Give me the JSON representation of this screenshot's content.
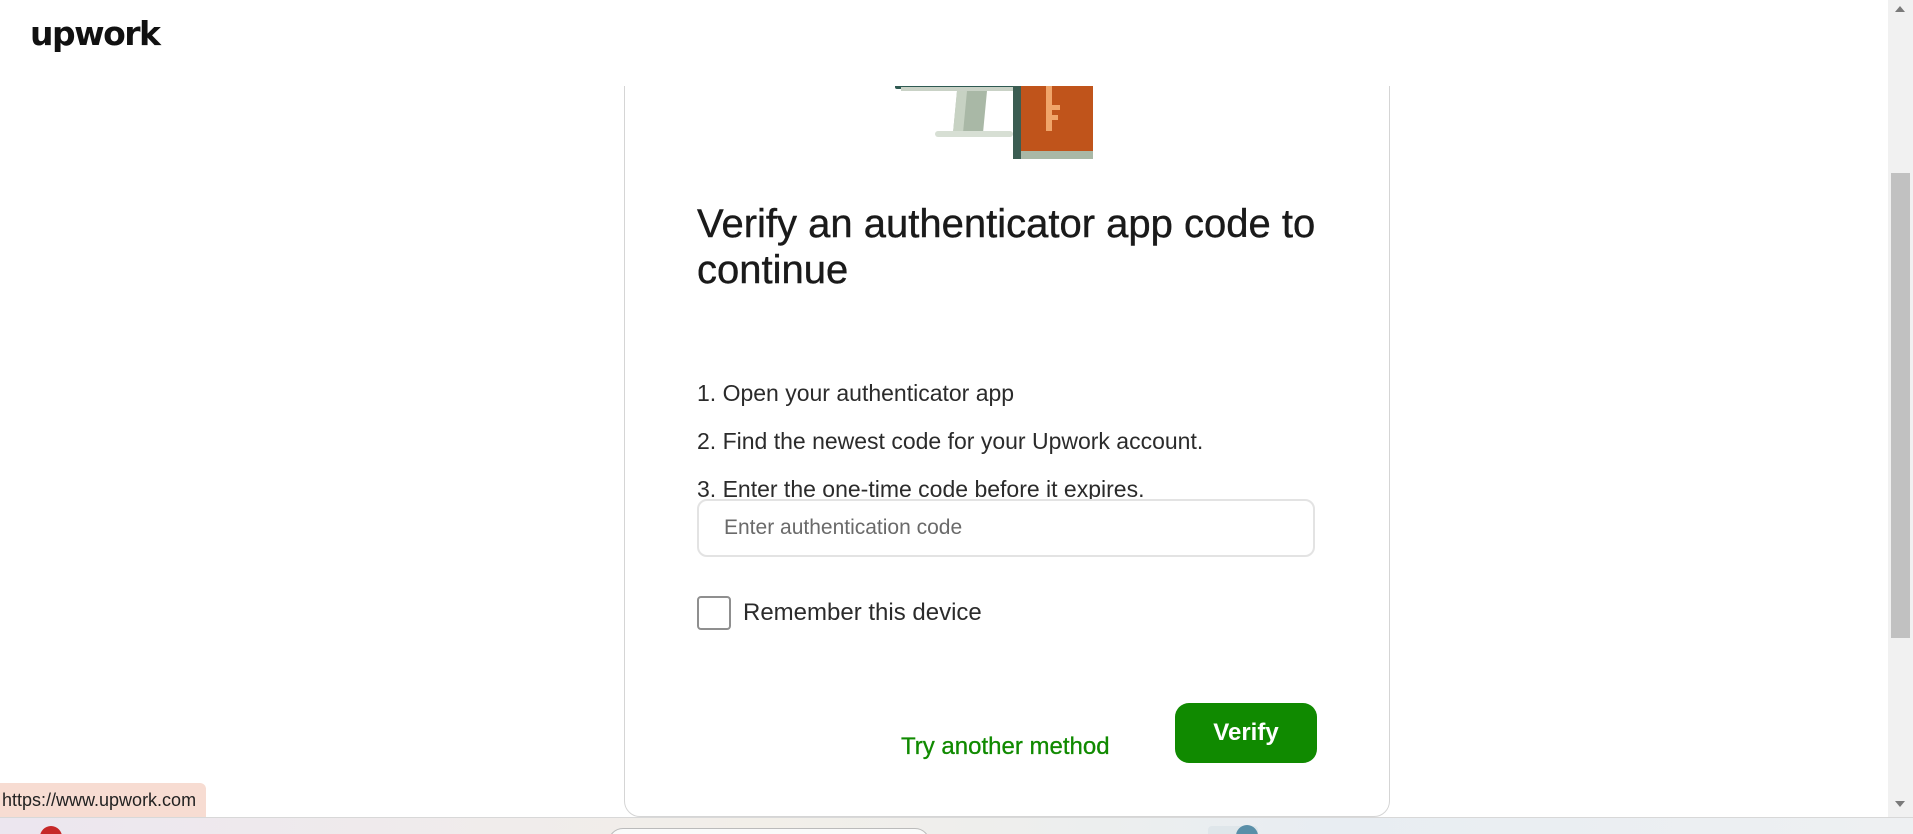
{
  "header": {
    "logo_text": "upwork"
  },
  "card": {
    "title": "Verify an authenticator app code to continue",
    "steps": [
      "1. Open your authenticator app",
      "2. Find the newest code for your Upwork account.",
      "3. Enter the one-time code before it expires."
    ],
    "code_input": {
      "value": "",
      "placeholder": "Enter authentication code"
    },
    "remember_label": "Remember this device",
    "remember_checked": false,
    "try_another_label": "Try another method",
    "verify_label": "Verify"
  },
  "status_bar": {
    "url": "https://www.upwork.com"
  },
  "colors": {
    "brand_green": "#108a00",
    "illustration_orange": "#c0541b",
    "illustration_gray": "#9fb0a0"
  }
}
